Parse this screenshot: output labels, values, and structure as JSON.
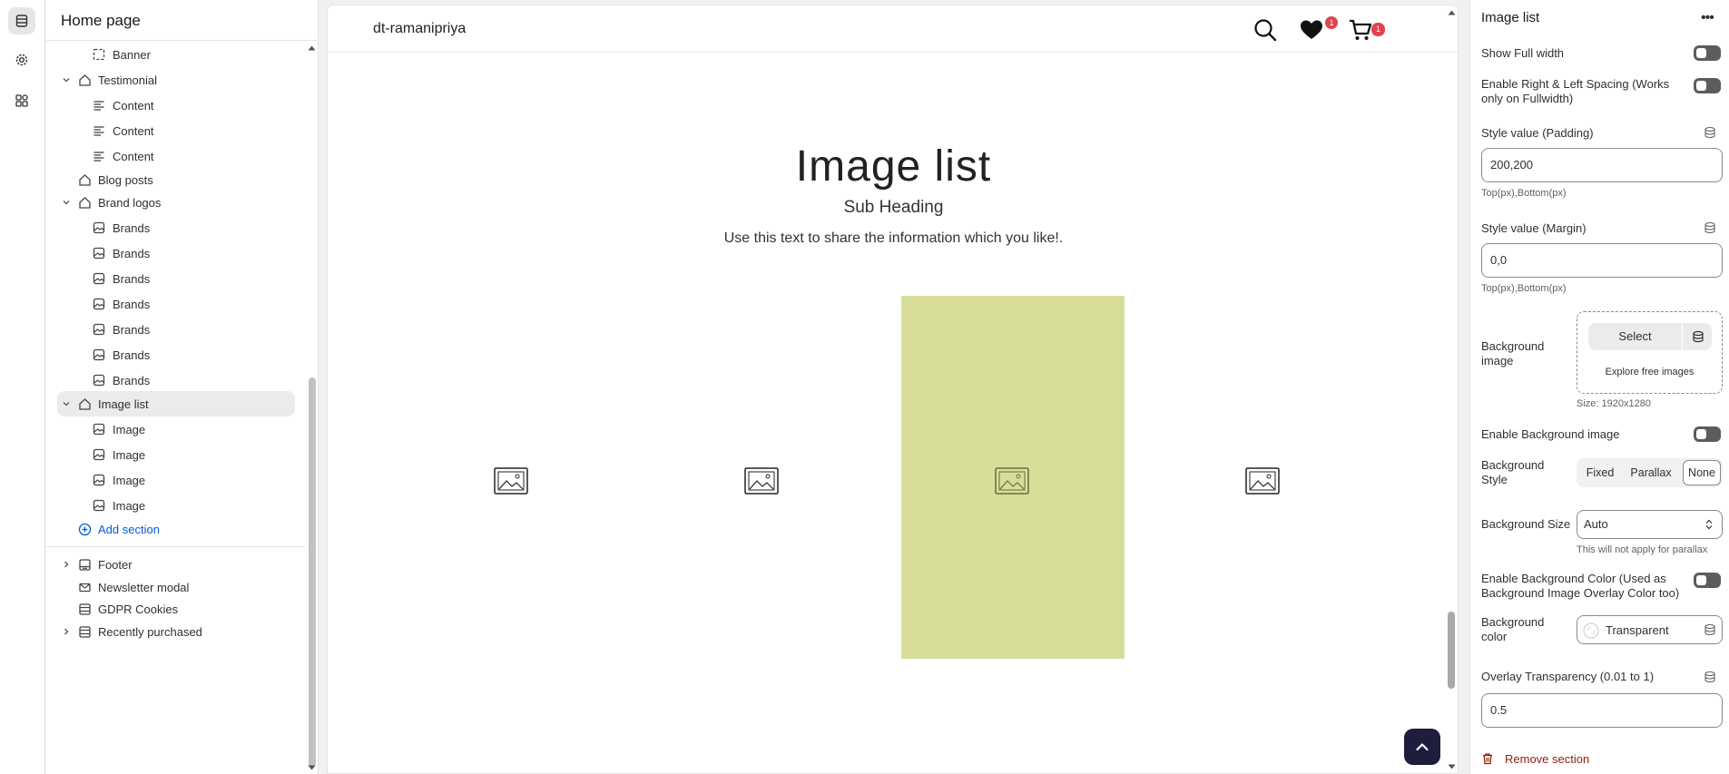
{
  "sidebar_title": "Home page",
  "tree": {
    "banner": "Banner",
    "testimonial": "Testimonial",
    "content": "Content",
    "blog_posts": "Blog posts",
    "brand_logos": "Brand logos",
    "brands": "Brands",
    "image_list": "Image list",
    "image": "Image",
    "add_section": "Add section",
    "footer": "Footer",
    "newsletter_modal": "Newsletter modal",
    "gdpr_cookies": "GDPR Cookies",
    "recently_purchased": "Recently purchased"
  },
  "preview": {
    "store_name": "dt-ramanipriya",
    "wishlist_count": "1",
    "cart_count": "1",
    "title": "Image list",
    "sub_heading": "Sub Heading",
    "text": "Use this text to share the information which you like!.",
    "active_card_color": "#d8de9a"
  },
  "settings": {
    "title": "Image list",
    "more": "•••",
    "show_full_width": "Show Full width",
    "enable_spacing": "Enable Right & Left Spacing (Works only on Fullwidth)",
    "padding_label": "Style value (Padding)",
    "padding_value": "200,200",
    "padding_help": "Top(px),Bottom(px)",
    "margin_label": "Style value (Margin)",
    "margin_value": "0,0",
    "margin_help": "Top(px),Bottom(px)",
    "bg_image_label": "Background image",
    "select_label": "Select",
    "explore_label": "Explore free images",
    "size_hint": "Size: 1920x1280",
    "enable_bg_image": "Enable Background image",
    "bg_style_label": "Background Style",
    "bg_style_options": [
      "Fixed",
      "Parallax",
      "None"
    ],
    "bg_style_selected": "None",
    "bg_size_label": "Background Size",
    "bg_size_value": "Auto",
    "bg_size_help": "This will not apply for parallax",
    "enable_bg_color": "Enable Background Color (Used as Background Image Overlay Color too)",
    "bg_color_label": "Background color",
    "bg_color_value": "Transparent",
    "overlay_label": "Overlay Transparency (0.01 to 1)",
    "overlay_value": "0.5",
    "remove_label": "Remove section"
  }
}
